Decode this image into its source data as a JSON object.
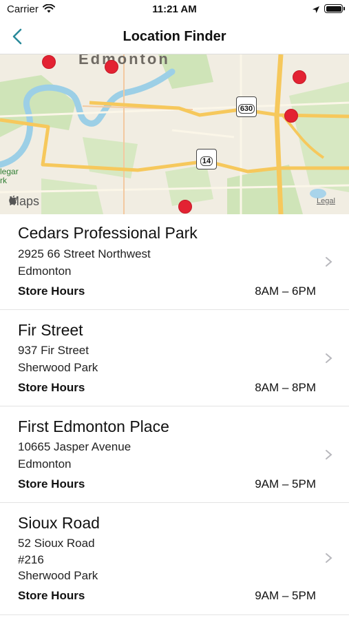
{
  "status_bar": {
    "carrier": "Carrier",
    "time": "11:21 AM"
  },
  "nav": {
    "title": "Location Finder",
    "back_icon": "chevron-left-icon",
    "accent_color": "#2a8a9a"
  },
  "map": {
    "city_label": "Edmonton",
    "park_label_1": "legar",
    "park_label_2": "rk",
    "highway_1": "630",
    "highway_2": "14",
    "logo_text": "Maps",
    "legal_text": "Legal",
    "pin_color": "#e32232"
  },
  "stores": [
    {
      "name": "Cedars Professional Park",
      "address": [
        "2925 66 Street Northwest",
        "Edmonton"
      ],
      "hours_label": "Store Hours",
      "hours": "8AM – 6PM"
    },
    {
      "name": "Fir Street",
      "address": [
        "937 Fir Street",
        "Sherwood Park"
      ],
      "hours_label": "Store Hours",
      "hours": "8AM – 8PM"
    },
    {
      "name": "First Edmonton Place",
      "address": [
        "10665 Jasper Avenue",
        "Edmonton"
      ],
      "hours_label": "Store Hours",
      "hours": "9AM – 5PM"
    },
    {
      "name": "Sioux Road",
      "address": [
        "52 Sioux Road",
        "#216",
        "Sherwood Park"
      ],
      "hours_label": "Store Hours",
      "hours": "9AM – 5PM"
    }
  ]
}
